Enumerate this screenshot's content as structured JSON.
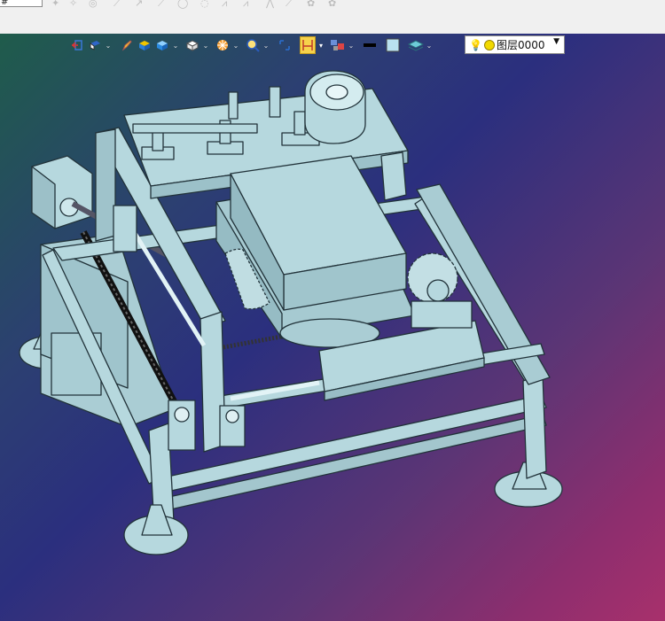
{
  "app": {
    "top_input_value": "#"
  },
  "toolbar": {
    "icons": [
      "exit-view-icon",
      "view-orient-icon",
      "sketch-pencil-icon",
      "shaded-box-icon",
      "view-cube-icon",
      "wireframe-box-icon",
      "section-wheel-icon",
      "zoom-icon",
      "fit-frame-icon",
      "dimension-bracket-icon",
      "display-style-icon",
      "color-swatch-black-icon",
      "color-swatch-light-icon",
      "layer-stack-icon"
    ],
    "layer_selector": {
      "current_layer": "图层0000"
    }
  },
  "colors": {
    "part_fill": "#b6d8de",
    "part_edge": "#22333a",
    "highlight_button": "#f6d24b"
  }
}
